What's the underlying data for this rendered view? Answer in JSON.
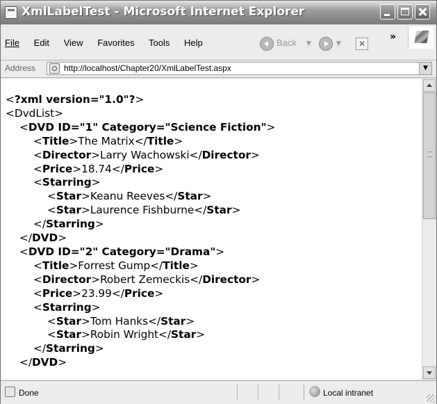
{
  "window": {
    "title": "XmlLabelTest - Microsoft Internet Explorer"
  },
  "menu": {
    "items": [
      "File",
      "Edit",
      "View",
      "Favorites",
      "Tools",
      "Help"
    ],
    "back_label": "Back"
  },
  "address": {
    "label": "Address",
    "url": "http://localhost/Chapter20/XmlLabelTest.aspx"
  },
  "xml": {
    "lines": [
      {
        "indent": 0,
        "parts": [
          [
            "<",
            0
          ],
          [
            "?xml version=\"1.0\"?",
            1
          ],
          [
            ">",
            0
          ]
        ]
      },
      {
        "indent": 0,
        "parts": [
          [
            "<",
            0
          ],
          [
            "DvdList",
            0
          ],
          [
            ">",
            0
          ]
        ]
      },
      {
        "indent": 1,
        "parts": [
          [
            "<",
            0
          ],
          [
            "DVD ID=\"1\" Category=\"Science Fiction\"",
            1
          ],
          [
            ">",
            0
          ]
        ]
      },
      {
        "indent": 2,
        "parts": [
          [
            "<",
            0
          ],
          [
            "Title",
            1
          ],
          [
            ">The Matrix</",
            0
          ],
          [
            "Title",
            1
          ],
          [
            ">",
            0
          ]
        ]
      },
      {
        "indent": 2,
        "parts": [
          [
            "<",
            0
          ],
          [
            "Director",
            1
          ],
          [
            ">Larry Wachowski</",
            0
          ],
          [
            "Director",
            1
          ],
          [
            ">",
            0
          ]
        ]
      },
      {
        "indent": 2,
        "parts": [
          [
            "<",
            0
          ],
          [
            "Price",
            1
          ],
          [
            ">18.74</",
            0
          ],
          [
            "Price",
            1
          ],
          [
            ">",
            0
          ]
        ]
      },
      {
        "indent": 2,
        "parts": [
          [
            "<",
            0
          ],
          [
            "Starring",
            1
          ],
          [
            ">",
            0
          ]
        ]
      },
      {
        "indent": 3,
        "parts": [
          [
            "<",
            0
          ],
          [
            "Star",
            1
          ],
          [
            ">Keanu Reeves</",
            0
          ],
          [
            "Star",
            1
          ],
          [
            ">",
            0
          ]
        ]
      },
      {
        "indent": 3,
        "parts": [
          [
            "<",
            0
          ],
          [
            "Star",
            1
          ],
          [
            ">Laurence Fishburne</",
            0
          ],
          [
            "Star",
            1
          ],
          [
            ">",
            0
          ]
        ]
      },
      {
        "indent": 2,
        "parts": [
          [
            "</",
            0
          ],
          [
            "Starring",
            1
          ],
          [
            ">",
            0
          ]
        ]
      },
      {
        "indent": 1,
        "parts": [
          [
            "</",
            0
          ],
          [
            "DVD",
            1
          ],
          [
            ">",
            0
          ]
        ]
      },
      {
        "indent": 1,
        "parts": [
          [
            "<",
            0
          ],
          [
            "DVD ID=\"2\" Category=\"Drama\"",
            1
          ],
          [
            ">",
            0
          ]
        ]
      },
      {
        "indent": 2,
        "parts": [
          [
            "<",
            0
          ],
          [
            "Title",
            1
          ],
          [
            ">Forrest Gump</",
            0
          ],
          [
            "Title",
            1
          ],
          [
            ">",
            0
          ]
        ]
      },
      {
        "indent": 2,
        "parts": [
          [
            "<",
            0
          ],
          [
            "Director",
            1
          ],
          [
            ">Robert Zemeckis</",
            0
          ],
          [
            "Director",
            1
          ],
          [
            ">",
            0
          ]
        ]
      },
      {
        "indent": 2,
        "parts": [
          [
            "<",
            0
          ],
          [
            "Price",
            1
          ],
          [
            ">23.99</",
            0
          ],
          [
            "Price",
            1
          ],
          [
            ">",
            0
          ]
        ]
      },
      {
        "indent": 2,
        "parts": [
          [
            "<",
            0
          ],
          [
            "Starring",
            1
          ],
          [
            ">",
            0
          ]
        ]
      },
      {
        "indent": 3,
        "parts": [
          [
            "<",
            0
          ],
          [
            "Star",
            1
          ],
          [
            ">Tom Hanks</",
            0
          ],
          [
            "Star",
            1
          ],
          [
            ">",
            0
          ]
        ]
      },
      {
        "indent": 3,
        "parts": [
          [
            "<",
            0
          ],
          [
            "Star",
            1
          ],
          [
            ">Robin Wright</",
            0
          ],
          [
            "Star",
            1
          ],
          [
            ">",
            0
          ]
        ]
      },
      {
        "indent": 2,
        "parts": [
          [
            "</",
            0
          ],
          [
            "Starring",
            1
          ],
          [
            ">",
            0
          ]
        ]
      },
      {
        "indent": 1,
        "parts": [
          [
            "</",
            0
          ],
          [
            "DVD",
            1
          ],
          [
            ">",
            0
          ]
        ]
      }
    ]
  },
  "status": {
    "text": "Done",
    "zone": "Local intranet"
  }
}
